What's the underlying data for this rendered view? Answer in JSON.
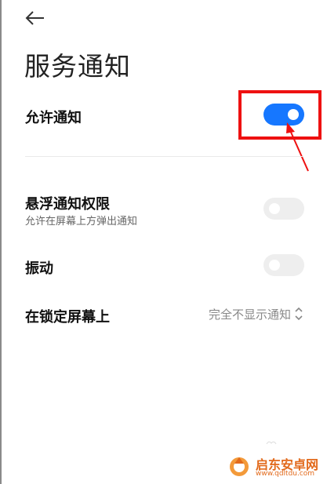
{
  "header": {
    "back_icon": "back-arrow-icon",
    "title": "服务通知"
  },
  "settings": {
    "allow_notifications": {
      "label": "允许通知",
      "enabled": true
    },
    "floating_notifications": {
      "label": "悬浮通知权限",
      "sublabel": "允许在屏幕上方弹出通知",
      "enabled": false
    },
    "vibration": {
      "label": "振动",
      "enabled": false
    },
    "lock_screen": {
      "label": "在锁定屏幕上",
      "value": "完全不显示通知",
      "icon": "chevron-up-down-icon"
    }
  },
  "annotation": {
    "color": "#ee1111"
  },
  "watermark": {
    "title": "启东安卓网",
    "url": "www.qdltdu.com",
    "color": "#e26a1c"
  },
  "colors": {
    "accent": "#1677ff",
    "toggle_off": "#eeeeee"
  }
}
